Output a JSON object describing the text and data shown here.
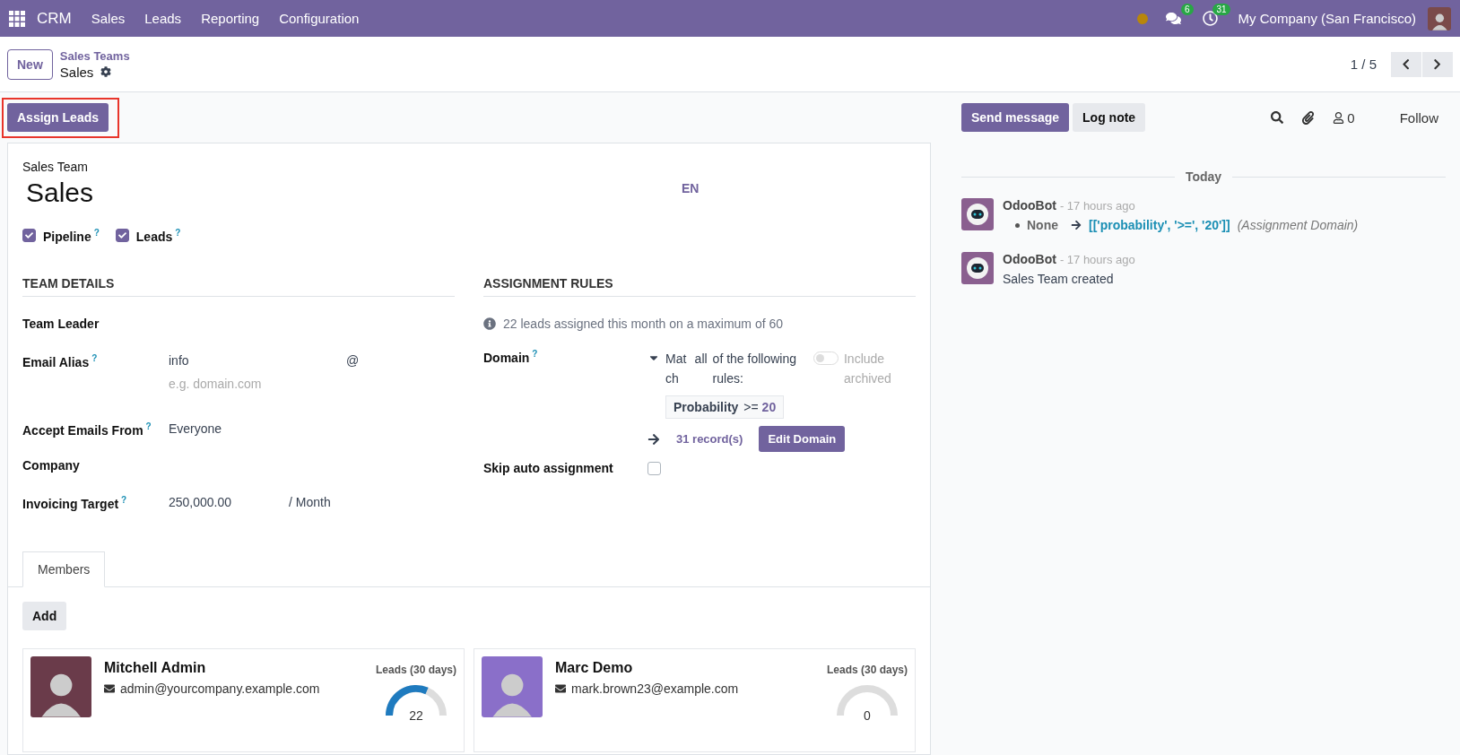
{
  "navbar": {
    "app": "CRM",
    "menu": [
      "Sales",
      "Leads",
      "Reporting",
      "Configuration"
    ],
    "messages_count": "6",
    "activities_count": "31",
    "company": "My Company (San Francisco)"
  },
  "control_panel": {
    "new_button": "New",
    "breadcrumb": "Sales Teams",
    "record": "Sales",
    "pager": "1 / 5"
  },
  "actions": {
    "assign_button": "Assign Leads"
  },
  "form": {
    "title_label": "Sales Team",
    "name": "Sales",
    "language": "EN",
    "options": [
      {
        "label": "Pipeline",
        "help": "?",
        "checked": true
      },
      {
        "label": "Leads",
        "help": "?",
        "checked": true
      }
    ],
    "team_details": {
      "heading": "TEAM DETAILS",
      "fields": [
        {
          "kind": "empty",
          "label": "Team Leader"
        },
        {
          "kind": "alias",
          "label": "Email Alias",
          "help": "?",
          "value": "info",
          "at": "@",
          "placeholder": "e.g. domain.com"
        },
        {
          "kind": "text",
          "label": "Accept Emails From",
          "help": "?",
          "value": "Everyone"
        },
        {
          "kind": "empty",
          "label": "Company"
        },
        {
          "kind": "target",
          "label": "Invoicing Target",
          "help": "?",
          "value": "250,000.00",
          "unit": "/ Month"
        }
      ]
    },
    "assignment": {
      "heading": "ASSIGNMENT RULES",
      "info": "22 leads assigned this month on a maximum of 60",
      "domain": {
        "label": "Domain",
        "help": "?",
        "match": [
          "Match",
          "all",
          "of the following rules:"
        ],
        "include_archived": {
          "label": "Include archived",
          "on": false
        },
        "rule": {
          "field": "Probability",
          "operator": ">=",
          "value": "20"
        },
        "records": "31 record(s)",
        "edit_button": "Edit Domain"
      },
      "skip": {
        "label": "Skip auto assignment",
        "checked": false
      }
    },
    "tabs": [
      {
        "label": "Members",
        "selected": true
      }
    ],
    "add_button": "Add",
    "members": [
      {
        "name": "Mitchell Admin",
        "email": "admin@yourcompany.example.com",
        "leads_label": "Leads (30 days)",
        "count": "22",
        "level": 0.7
      },
      {
        "name": "Marc Demo",
        "email": "mark.brown23@example.com",
        "leads_label": "Leads (30 days)",
        "count": "0"
      }
    ]
  },
  "chatter": {
    "send_button": "Send message",
    "log_button": "Log note",
    "followers": "0",
    "follow": "Follow",
    "date_divider": "Today",
    "messages": [
      {
        "kind": "tracking",
        "author": "OdooBot",
        "time": "- 17 hours ago",
        "old": "None",
        "new": "[['probability', '>=', '20']]",
        "field": "(Assignment Domain)"
      },
      {
        "kind": "text",
        "author": "OdooBot",
        "time": "- 17 hours ago",
        "body": "Sales Team created"
      }
    ]
  }
}
